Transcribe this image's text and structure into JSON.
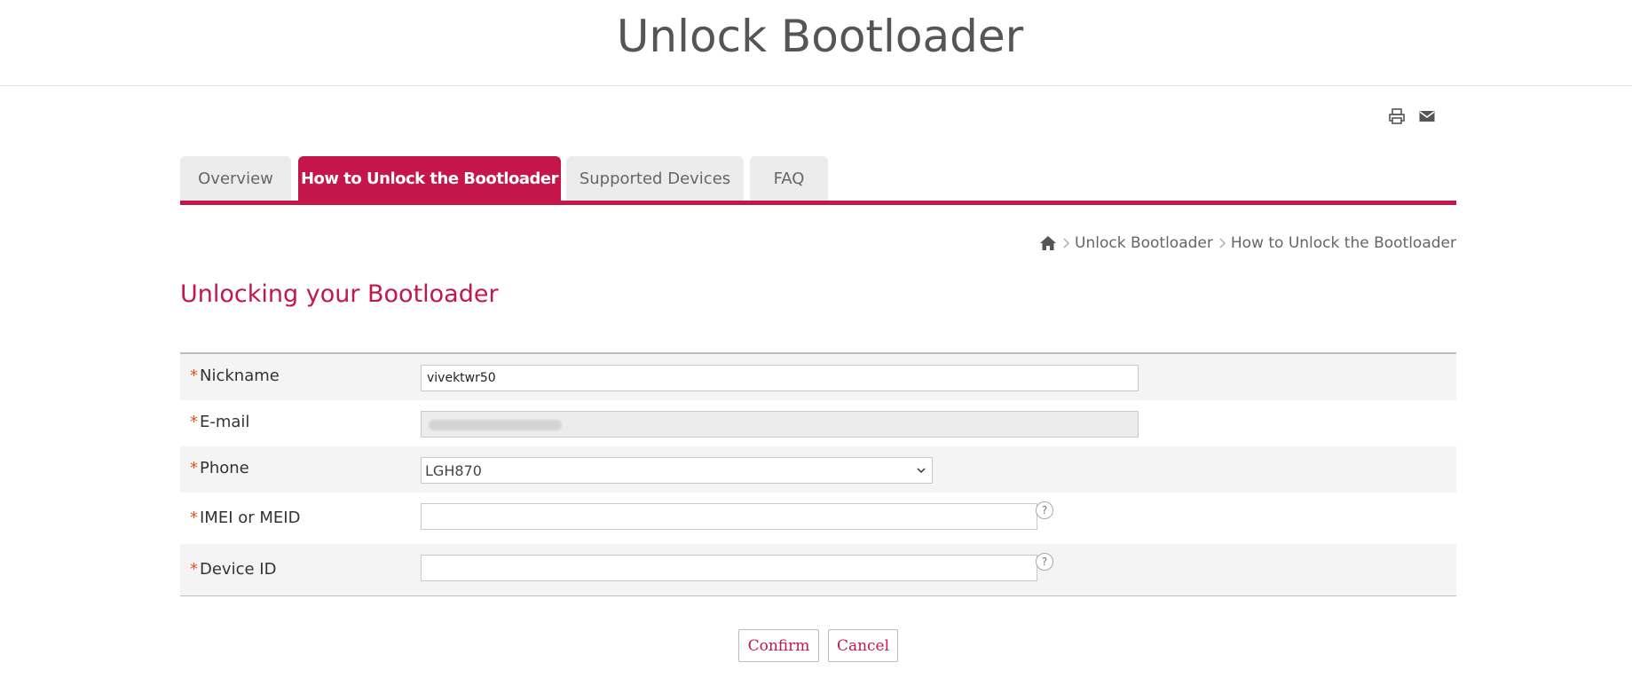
{
  "header": {
    "title": "Unlock Bootloader"
  },
  "utility": {
    "print_icon": "print-icon",
    "email_icon": "email-icon"
  },
  "tabs": [
    {
      "label": "Overview",
      "active": false
    },
    {
      "label": "How to Unlock the Bootloader",
      "active": true
    },
    {
      "label": "Supported Devices",
      "active": false
    },
    {
      "label": "FAQ",
      "active": false
    }
  ],
  "breadcrumb": {
    "home_icon": "home-icon",
    "items": [
      "Unlock Bootloader",
      "How to Unlock the Bootloader"
    ]
  },
  "section": {
    "title": "Unlocking your Bootloader"
  },
  "form": {
    "required_mark": "*",
    "nickname": {
      "label": "Nickname",
      "value": "vivektwr50"
    },
    "email": {
      "label": "E-mail"
    },
    "phone": {
      "label": "Phone",
      "selected": "LGH870"
    },
    "imei": {
      "label": "IMEI or MEID",
      "value": "",
      "help": "?"
    },
    "device_id": {
      "label": "Device ID",
      "value": "",
      "help": "?"
    }
  },
  "buttons": {
    "confirm": "Confirm",
    "cancel": "Cancel"
  },
  "colors": {
    "accent": "#c4164b",
    "required": "#e6521f",
    "row_shade": "#f4f4f4"
  }
}
